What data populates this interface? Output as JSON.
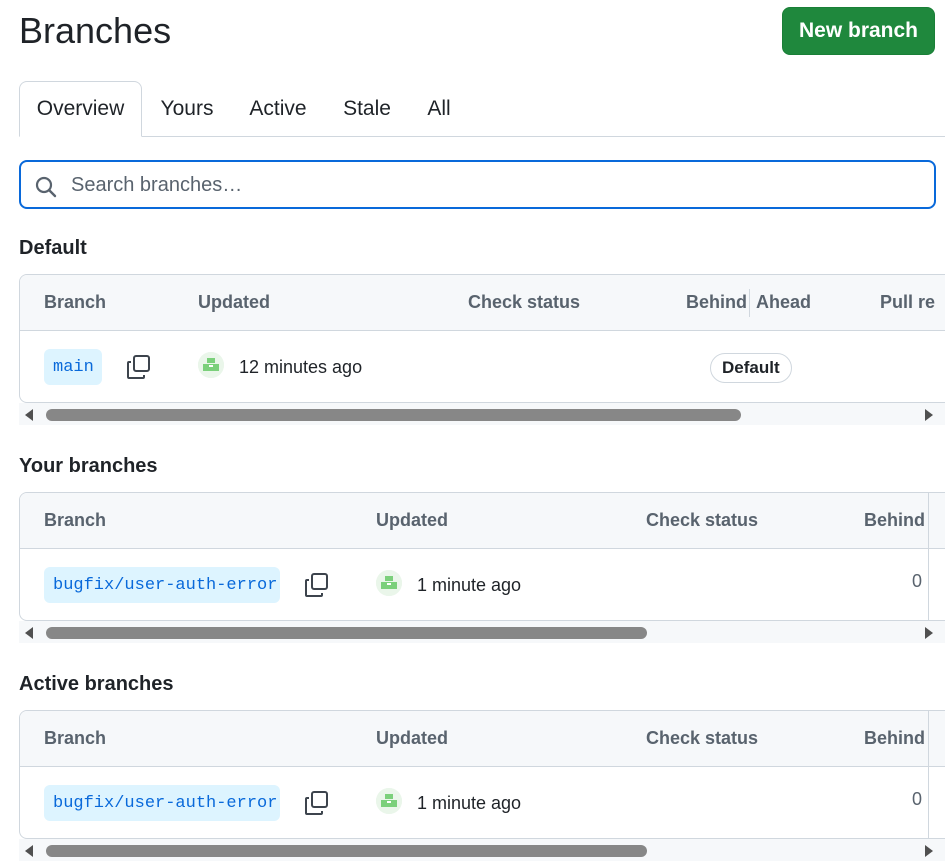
{
  "page_title": "Branches",
  "new_branch_label": "New branch",
  "tabs": [
    {
      "label": "Overview",
      "selected": true
    },
    {
      "label": "Yours",
      "selected": false
    },
    {
      "label": "Active",
      "selected": false
    },
    {
      "label": "Stale",
      "selected": false
    },
    {
      "label": "All",
      "selected": false
    }
  ],
  "search": {
    "placeholder": "Search branches…",
    "value": "",
    "icon": "search-icon"
  },
  "sections": {
    "default": {
      "title": "Default",
      "headers": {
        "branch": "Branch",
        "updated": "Updated",
        "check_status": "Check status",
        "behind": "Behind",
        "ahead": "Ahead",
        "pull_request": "Pull re"
      },
      "row": {
        "branch": "main",
        "updated": "12 minutes ago",
        "badge": "Default"
      }
    },
    "yours": {
      "title": "Your branches",
      "headers": {
        "branch": "Branch",
        "updated": "Updated",
        "check_status": "Check status",
        "behind": "Behind"
      },
      "row": {
        "branch": "bugfix/user-auth-error",
        "updated": "1 minute ago",
        "behind": "0"
      }
    },
    "active": {
      "title": "Active branches",
      "headers": {
        "branch": "Branch",
        "updated": "Updated",
        "check_status": "Check status",
        "behind": "Behind"
      },
      "row": {
        "branch": "bugfix/user-auth-error",
        "updated": "1 minute ago",
        "behind": "0"
      }
    }
  },
  "colors": {
    "primary_button": "#1f883d",
    "focus": "#0969da",
    "branch_pill_bg": "#ddf4ff",
    "branch_pill_text": "#0969da"
  },
  "scroll_positions": {
    "default_thumb": 0.77,
    "yours_thumb": 0.65,
    "active_thumb": 0.65
  }
}
